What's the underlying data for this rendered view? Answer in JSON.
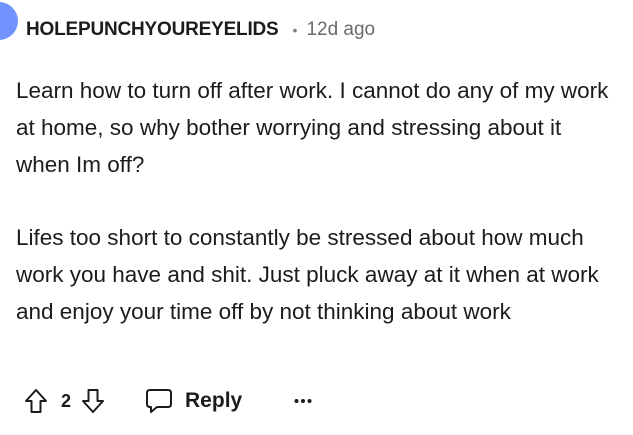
{
  "comment": {
    "username": "HOLEPUNCHYOUREYELIDS",
    "separator": "•",
    "timestamp": "12d ago",
    "paragraphs": [
      "Learn how to turn off after work. I cannot do any of my work at home, so why bother worrying and stressing about it when Im off?",
      "Lifes too short to constantly be stressed about how much work you have and shit. Just pluck away at it when at work and enjoy your time off by not thinking about work"
    ],
    "actions": {
      "upvote_icon": "arrow-up-outline-icon",
      "vote_count": "2",
      "downvote_icon": "arrow-down-outline-icon",
      "reply_icon": "speech-bubble-icon",
      "reply_label": "Reply",
      "more_icon": "ellipsis-icon"
    }
  },
  "colors": {
    "text": "#1c1c1c",
    "meta": "#6a6a6a",
    "avatar": "#7193ff"
  }
}
